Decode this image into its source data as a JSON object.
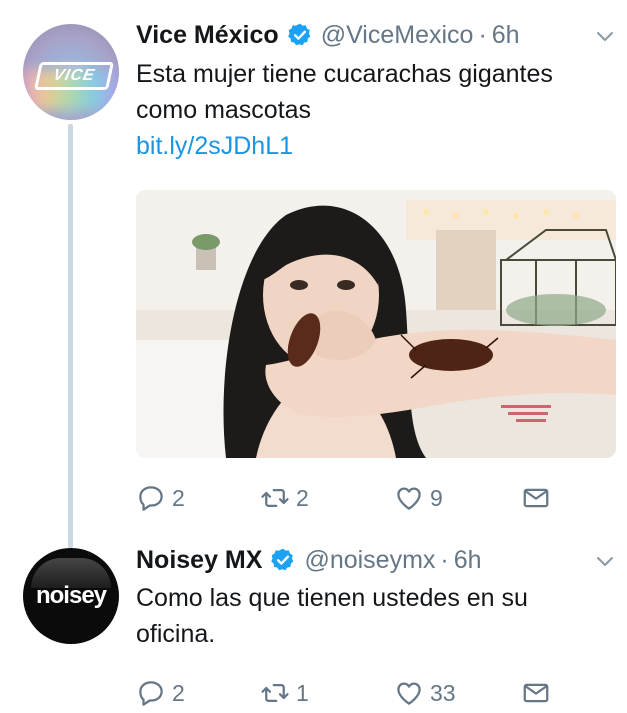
{
  "tweets": [
    {
      "display_name": "Vice México",
      "handle": "@ViceMexico",
      "separator": "·",
      "time": "6h",
      "avatar_text": "VICE",
      "text": "Esta mujer tiene cucarachas gigantes como mascotas",
      "link": "bit.ly/2sJDhL1",
      "has_media": true,
      "actions": {
        "replies": "2",
        "retweets": "2",
        "likes": "9"
      }
    },
    {
      "display_name": "Noisey MX",
      "handle": "@noiseymx",
      "separator": "·",
      "time": "6h",
      "avatar_text": "noisey",
      "text": "Como las que tienen ustedes en su oficina.",
      "actions": {
        "replies": "2",
        "retweets": "1",
        "likes": "33"
      }
    }
  ],
  "colors": {
    "link": "#1b95e0",
    "verified": "#1da1f2",
    "muted": "#657786",
    "thread_line": "#c9d8e2"
  },
  "icons": [
    "verified-badge-icon",
    "chevron-down-icon",
    "reply-icon",
    "retweet-icon",
    "like-icon",
    "direct-message-icon"
  ]
}
